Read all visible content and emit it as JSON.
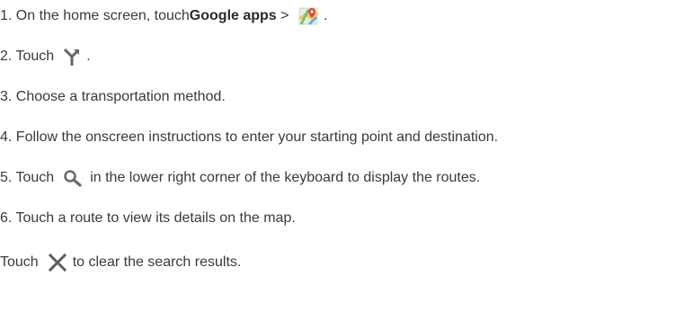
{
  "steps": [
    {
      "pre": "1. On the home screen, touch ",
      "bold": "Google apps",
      "mid": " > ",
      "post": " ."
    },
    {
      "pre": "2. Touch",
      "post": " ."
    },
    {
      "text": "3. Choose a transportation method."
    },
    {
      "text": "4. Follow the onscreen instructions to enter your starting point and destination."
    },
    {
      "pre": "5. Touch",
      "post": "in the lower right corner of the keyboard to display the routes."
    },
    {
      "text": "6. Touch a route to view its details on the map."
    },
    {
      "pre": "Touch",
      "post": "to clear the search results."
    }
  ],
  "icons": {
    "maps": "google-maps-icon",
    "route": "directions-icon",
    "search": "search-icon",
    "clear": "close-icon"
  },
  "colors": {
    "text": "#3a3a3a",
    "icon": "#6b6b6b"
  }
}
